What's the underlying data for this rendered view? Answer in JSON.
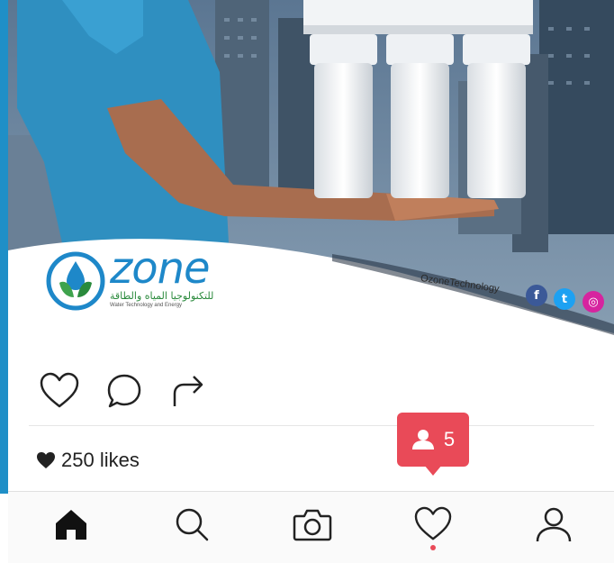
{
  "brand": {
    "name": "zone",
    "arabic_tagline": "للتكنولوجيا المياه والطاقة",
    "english_tagline": "Water Technology and Energy",
    "handle": "OzoneTechnology"
  },
  "social_icons": [
    {
      "icon": "facebook-icon",
      "glyph": "f",
      "color": "#3b5998"
    },
    {
      "icon": "twitter-icon",
      "glyph": "t",
      "color": "#1da1f2"
    },
    {
      "icon": "instagram-icon",
      "glyph": "◎",
      "color": "#d6249f"
    }
  ],
  "actions": {
    "like_icon": "heart-outline-icon",
    "comment_icon": "comment-icon",
    "share_icon": "share-arrow-icon"
  },
  "likes": {
    "text": "250 likes",
    "icon": "heart-filled-icon"
  },
  "notification": {
    "count": "5",
    "icon": "user-icon",
    "color": "#e94a58"
  },
  "bottom_nav": [
    {
      "icon": "home-icon",
      "active": true
    },
    {
      "icon": "search-icon",
      "active": false
    },
    {
      "icon": "camera-icon",
      "active": false
    },
    {
      "icon": "heart-icon",
      "active": false,
      "has_indicator": true
    },
    {
      "icon": "profile-icon",
      "active": false
    }
  ],
  "colors": {
    "accent_blue": "#1e88c9",
    "notification_red": "#e94a58"
  }
}
